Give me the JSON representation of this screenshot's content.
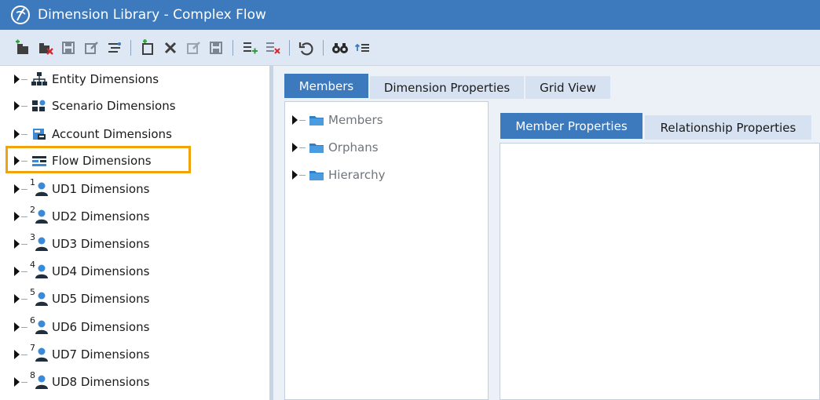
{
  "window": {
    "title": "Dimension Library - Complex Flow"
  },
  "toolbar": {
    "buttons": [
      "create-dimension-icon",
      "delete-dimension-icon",
      "save-dimension-icon",
      "edit-dimension-icon",
      "hierarchy-icon",
      "new-member-icon",
      "delete-member-icon",
      "edit-member-icon",
      "save-member-icon",
      "add-relationship-icon",
      "remove-relationship-icon",
      "refresh-icon",
      "search-binoculars-icon",
      "sort-icon"
    ]
  },
  "dimension_tree": {
    "items": [
      {
        "label": "Entity Dimensions",
        "icon": "entity-hierarchy-icon"
      },
      {
        "label": "Scenario Dimensions",
        "icon": "scenario-icon"
      },
      {
        "label": "Account Dimensions",
        "icon": "account-icon"
      },
      {
        "label": "Flow Dimensions",
        "icon": "flow-icon",
        "highlighted": true
      },
      {
        "label": "UD1 Dimensions",
        "icon": "user-defined-1-icon",
        "badge": "1"
      },
      {
        "label": "UD2 Dimensions",
        "icon": "user-defined-2-icon",
        "badge": "2"
      },
      {
        "label": "UD3 Dimensions",
        "icon": "user-defined-3-icon",
        "badge": "3"
      },
      {
        "label": "UD4 Dimensions",
        "icon": "user-defined-4-icon",
        "badge": "4"
      },
      {
        "label": "UD5 Dimensions",
        "icon": "user-defined-5-icon",
        "badge": "5"
      },
      {
        "label": "UD6 Dimensions",
        "icon": "user-defined-6-icon",
        "badge": "6"
      },
      {
        "label": "UD7 Dimensions",
        "icon": "user-defined-7-icon",
        "badge": "7"
      },
      {
        "label": "UD8 Dimensions",
        "icon": "user-defined-8-icon",
        "badge": "8"
      }
    ]
  },
  "main_tabs": [
    {
      "label": "Members",
      "active": true
    },
    {
      "label": "Dimension Properties",
      "active": false
    },
    {
      "label": "Grid View",
      "active": false
    }
  ],
  "members_tree": {
    "items": [
      {
        "label": "Members"
      },
      {
        "label": "Orphans"
      },
      {
        "label": "Hierarchy"
      }
    ]
  },
  "property_tabs": [
    {
      "label": "Member Properties",
      "active": true
    },
    {
      "label": "Relationship Properties",
      "active": false
    }
  ],
  "colors": {
    "accent": "#3d79bd",
    "toolbar_bg": "#dee7f4",
    "highlight": "#f0a30a",
    "panel_bg": "#ecf1f8",
    "user_blue": "#3b8ad8",
    "user_dark": "#1f2f3e"
  }
}
